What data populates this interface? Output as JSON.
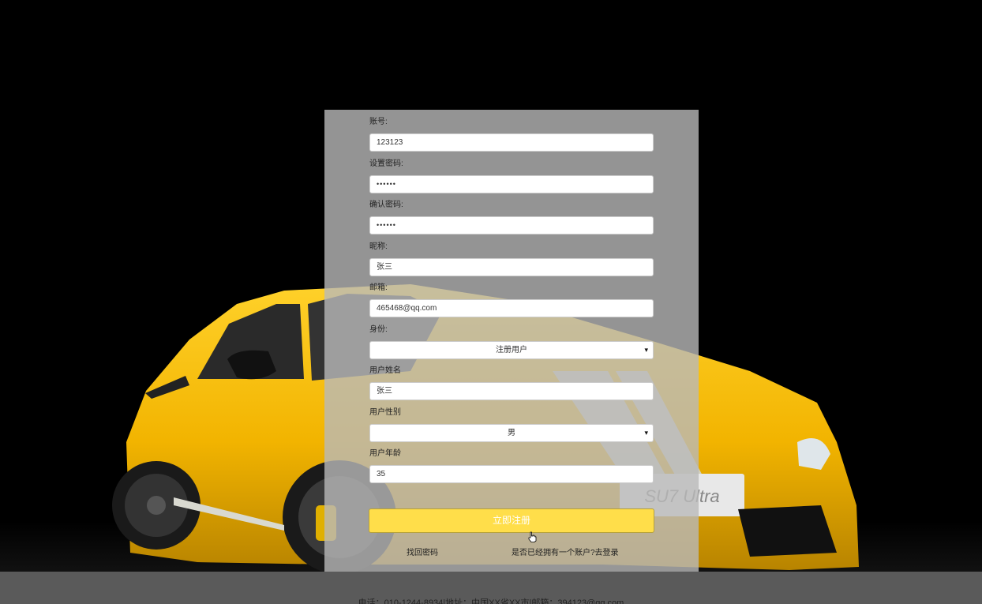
{
  "form": {
    "account": {
      "label": "账号:",
      "value": "123123"
    },
    "password": {
      "label": "设置密码:",
      "value": "••••••"
    },
    "confirm_password": {
      "label": "确认密码:",
      "value": "••••••"
    },
    "nickname": {
      "label": "昵称:",
      "value": "张三"
    },
    "email": {
      "label": "邮箱:",
      "value": "465468@qq.com"
    },
    "identity": {
      "label": "身份:",
      "value": "注册用户"
    },
    "user_name": {
      "label": "用户姓名",
      "value": "张三"
    },
    "gender": {
      "label": "用户性别",
      "value": "男"
    },
    "age": {
      "label": "用户年龄",
      "value": "35"
    },
    "submit_label": "立即注册",
    "forgot_label": "找回密码",
    "login_label": "是否已经拥有一个账户?去登录"
  },
  "background": {
    "plate_text": "SU7 Ultra",
    "car_color": "#f2b400"
  },
  "footer": {
    "text": "电话：010-1244-8934|地址：中国XX省XX市|邮箱：394123@qq.com"
  },
  "colors": {
    "accent": "#ffde4a",
    "panel": "#b9b9b9",
    "footer": "#5a5a5a"
  }
}
